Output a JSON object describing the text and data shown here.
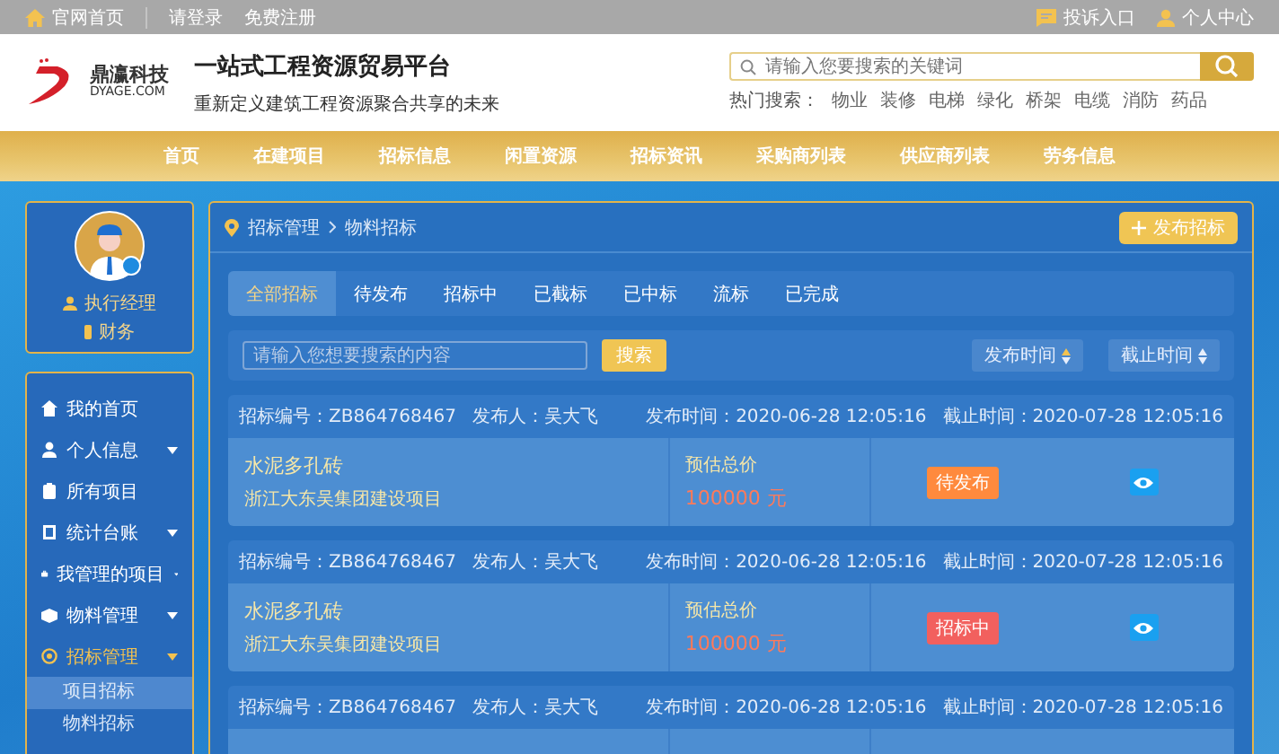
{
  "top_bar": {
    "home_link": "官网首页",
    "login": "请登录",
    "register": "免费注册",
    "complaint": "投诉入口",
    "user_center": "个人中心"
  },
  "header": {
    "logo_text": "鼎瀛科技",
    "logo_domain": "DYAGE.COM",
    "title": "一站式工程资源贸易平台",
    "subtitle": "重新定义建筑工程资源聚合共享的未来",
    "search": {
      "placeholder": "请输入您要搜索的关键词"
    },
    "hot_label": "热门搜索：",
    "hot_terms": [
      "物业",
      "装修",
      "电梯",
      "绿化",
      "桥架",
      "电缆",
      "消防",
      "药品"
    ]
  },
  "nav": [
    "首页",
    "在建项目",
    "招标信息",
    "闲置资源",
    "招标资讯",
    "采购商列表",
    "供应商列表",
    "劳务信息"
  ],
  "profile": {
    "roles": [
      {
        "kind": "person",
        "label": "执行经理"
      },
      {
        "kind": "badge",
        "label": "财务"
      }
    ]
  },
  "sidebar": {
    "items": [
      {
        "label": "我的首页",
        "expandable": false,
        "active": false
      },
      {
        "label": "个人信息",
        "expandable": true,
        "active": false
      },
      {
        "label": "所有项目",
        "expandable": false,
        "active": false
      },
      {
        "label": "统计台账",
        "expandable": true,
        "active": false
      },
      {
        "label": "我管理的项目",
        "expandable": true,
        "active": false
      },
      {
        "label": "物料管理",
        "expandable": true,
        "active": false
      },
      {
        "label": "招标管理",
        "expandable": true,
        "active": true,
        "children": [
          {
            "label": "项目招标",
            "selected": true
          },
          {
            "label": "物料招标",
            "selected": false
          }
        ]
      }
    ]
  },
  "breadcrumb": [
    "招标管理",
    "物料招标"
  ],
  "publish_button": "发布招标",
  "tabs": [
    {
      "label": "全部招标",
      "selected": true
    },
    {
      "label": "待发布",
      "selected": false
    },
    {
      "label": "招标中",
      "selected": false
    },
    {
      "label": "已截标",
      "selected": false
    },
    {
      "label": "已中标",
      "selected": false
    },
    {
      "label": "流标",
      "selected": false
    },
    {
      "label": "已完成",
      "selected": false
    }
  ],
  "filter": {
    "placeholder": "请输入您想要搜索的内容",
    "search_button": "搜索",
    "sorts": [
      {
        "label": "发布时间",
        "selected": true
      },
      {
        "label": "截止时间",
        "selected": false
      }
    ]
  },
  "cards": [
    {
      "id": "招标编号：ZB864768467",
      "publisher": "发布人：吴大飞",
      "published": "发布时间：2020-06-28 12:05:16",
      "deadline": "截止时间：2020-07-28 12:05:16",
      "title": "水泥多孔砖",
      "project": "浙江大东吴集团建设项目",
      "price_label": "预估总价",
      "price": "100000 元",
      "status": {
        "kind": "pending",
        "label": "待发布"
      }
    },
    {
      "id": "招标编号：ZB864768467",
      "publisher": "发布人：吴大飞",
      "published": "发布时间：2020-06-28 12:05:16",
      "deadline": "截止时间：2020-07-28 12:05:16",
      "title": "水泥多孔砖",
      "project": "浙江大东吴集团建设项目",
      "price_label": "预估总价",
      "price": "100000 元",
      "status": {
        "kind": "bidding",
        "label": "招标中"
      }
    },
    {
      "id": "招标编号：ZB864768467",
      "publisher": "发布人：吴大飞",
      "published": "发布时间：2020-06-28 12:05:16",
      "deadline": "截止时间：2020-07-28 12:05:16"
    }
  ]
}
